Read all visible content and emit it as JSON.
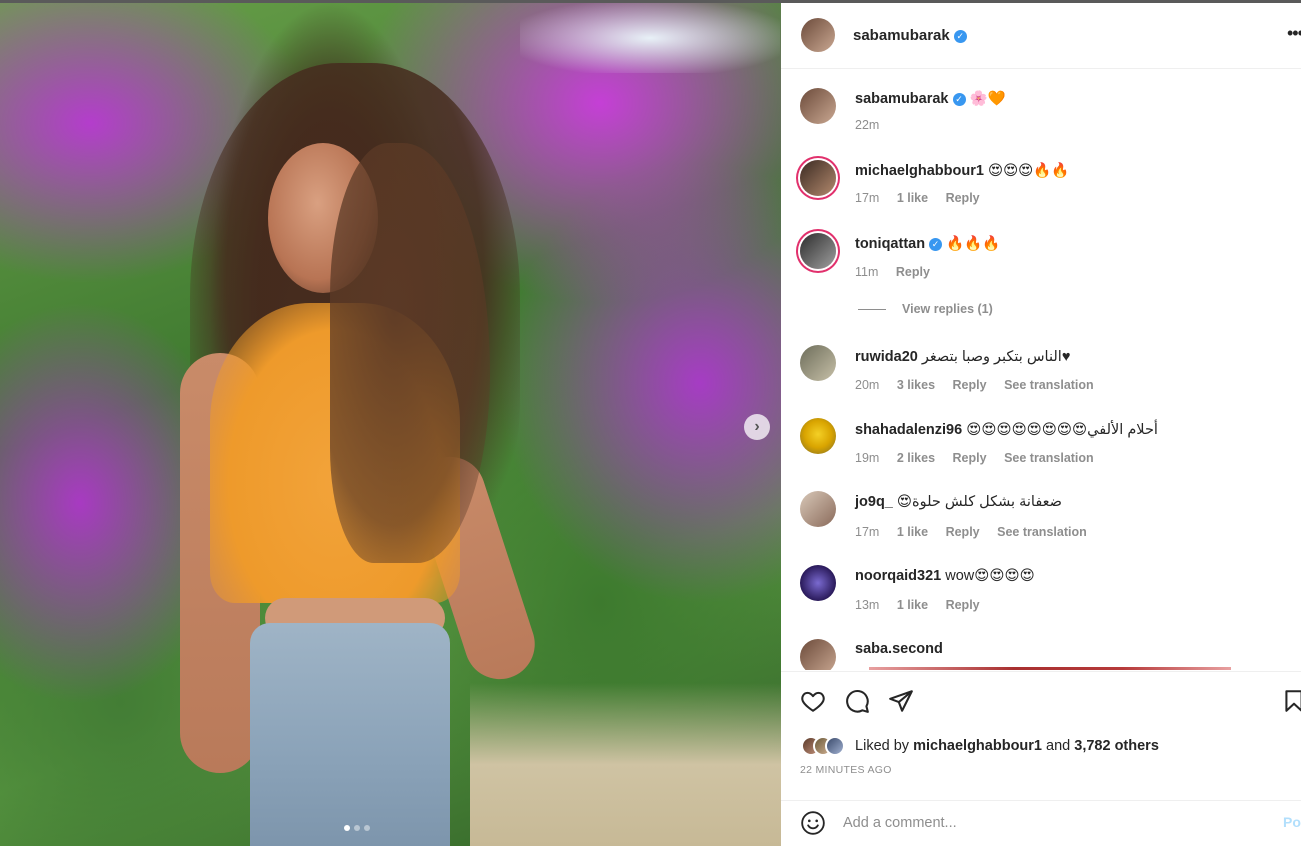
{
  "post": {
    "author": "sabamubarak",
    "time_ago": "22 MINUTES AGO"
  },
  "caption": {
    "username": "sabamubarak",
    "text": "🌸🧡",
    "time": "22m"
  },
  "comments": [
    {
      "username": "michaelghabbour1",
      "text": "😍😍😍🔥🔥",
      "time": "17m",
      "likes": "1 like",
      "reply": "Reply",
      "translate": ""
    },
    {
      "username": "toniqattan",
      "text": "🔥🔥🔥",
      "time": "11m",
      "likes": "",
      "reply": "Reply",
      "translate": ""
    },
    {
      "username": "ruwida20",
      "text": "الناس بتكبر وصبا بتصغر♥",
      "time": "20m",
      "likes": "3 likes",
      "reply": "Reply",
      "translate": "See translation"
    },
    {
      "username": "shahadalenzi96",
      "text": "😍😍😍😍😍😍😍😍أحلام الألفي",
      "time": "19m",
      "likes": "2 likes",
      "reply": "Reply",
      "translate": "See translation"
    },
    {
      "username": "jo9q_",
      "text": "😍ضعفانة بشكل كلش حلوة",
      "time": "17m",
      "likes": "1 like",
      "reply": "Reply",
      "translate": "See translation"
    },
    {
      "username": "noorqaid321",
      "text": "wow😍😍😍😍",
      "time": "13m",
      "likes": "1 like",
      "reply": "Reply",
      "translate": ""
    },
    {
      "username": "saba.second",
      "text": "",
      "time": "",
      "likes": "",
      "reply": "",
      "translate": ""
    }
  ],
  "view_replies": "View replies (1)",
  "likes": {
    "prefix": "Liked by",
    "user": "michaelghabbour1",
    "and": "and",
    "others": "3,782 others"
  },
  "add_comment": {
    "placeholder": "Add a comment...",
    "post_label": "Post"
  },
  "icons": {
    "verified": "verified-badge-icon",
    "more": "more-options-icon",
    "like": "heart-icon",
    "comment": "comment-bubble-icon",
    "share": "paper-plane-icon",
    "save": "bookmark-icon",
    "emoji": "smiley-icon",
    "next": "chevron-right-icon"
  },
  "colors": {
    "verified_blue": "#3897f0",
    "secondary_text": "#8e8e8e",
    "post_button_disabled": "#b2dffc",
    "story_ring": "#e1306c"
  },
  "carousel": {
    "count": 3,
    "active": 1
  }
}
